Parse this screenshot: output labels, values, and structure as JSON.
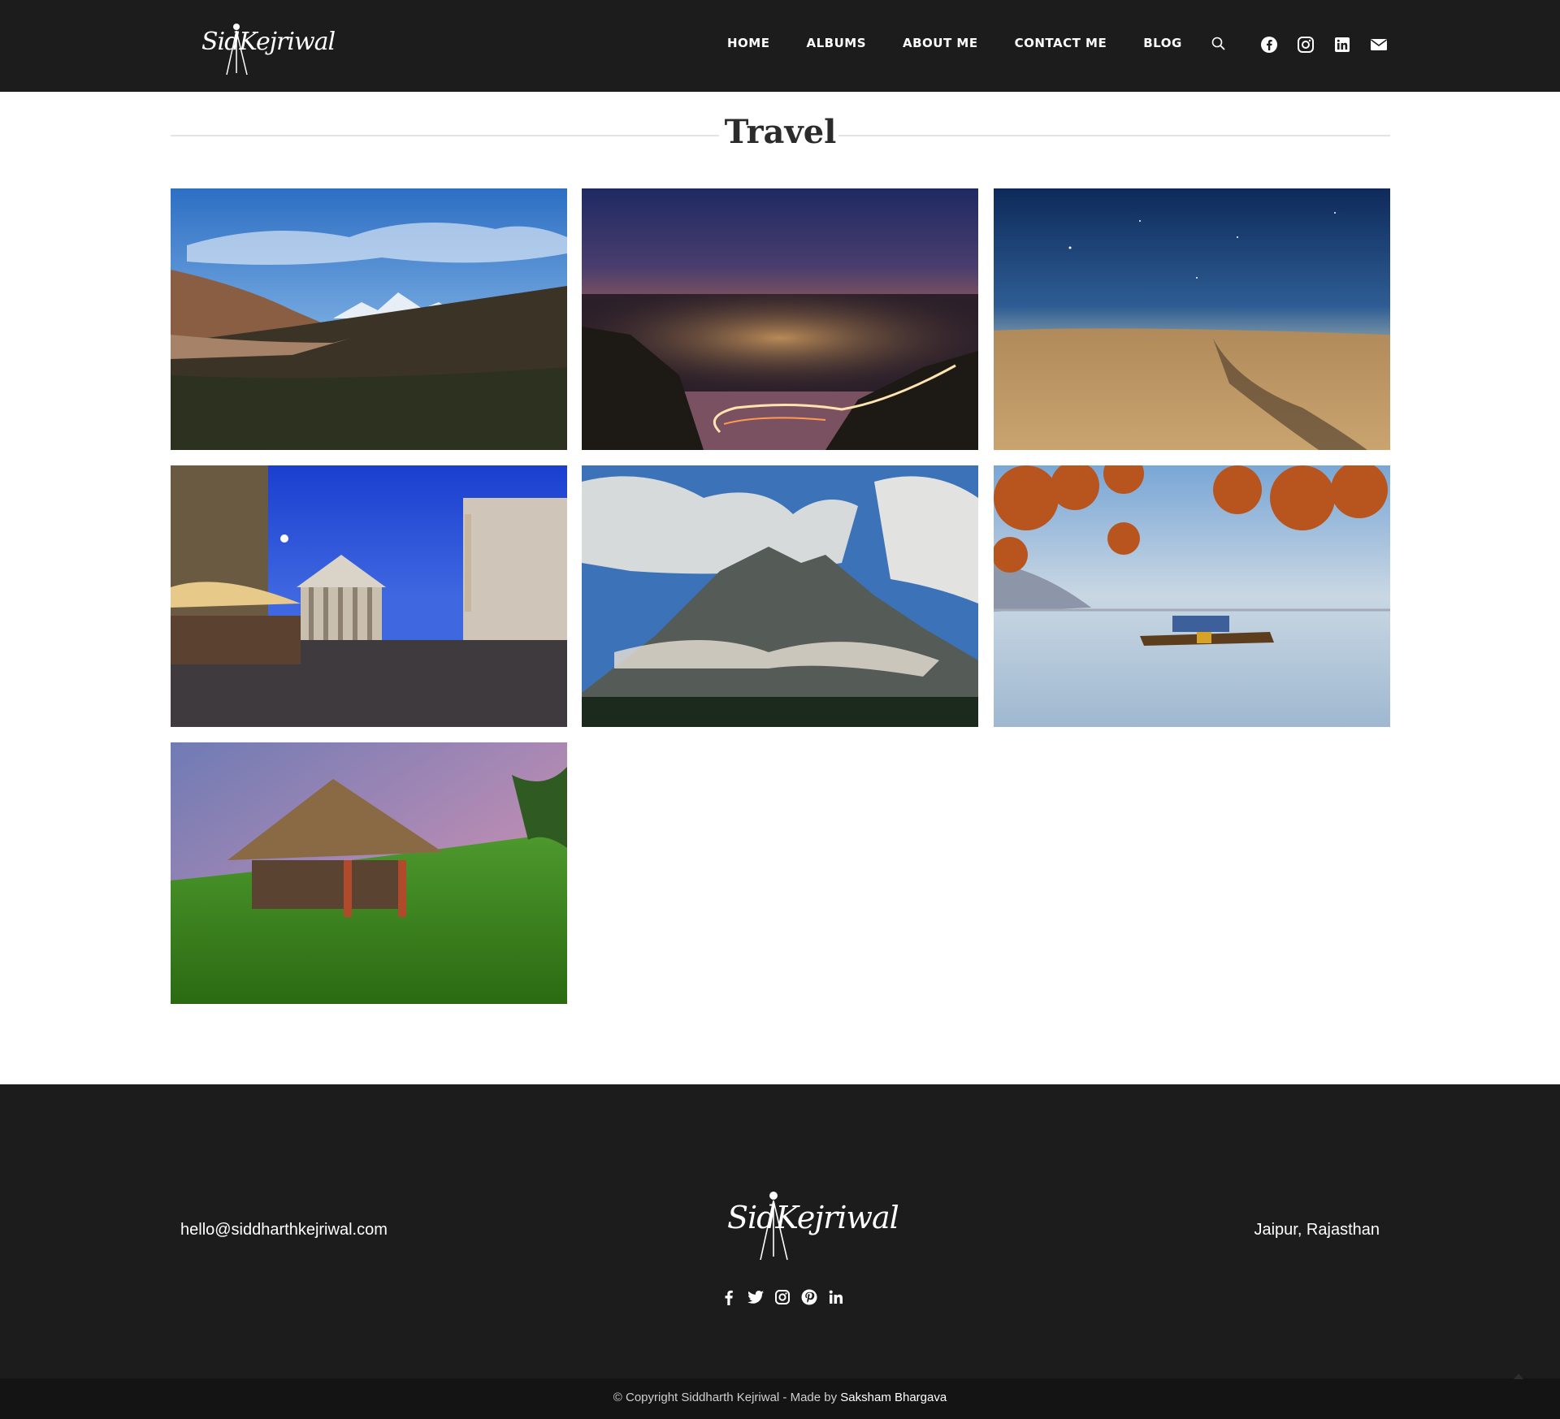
{
  "site": {
    "logo_text": "SidKejriwal"
  },
  "nav": {
    "items": [
      "HOME",
      "ALBUMS",
      "ABOUT ME",
      "CONTACT ME",
      "BLOG"
    ],
    "icons": [
      "search-icon",
      "facebook-icon",
      "instagram-icon",
      "linkedin-icon",
      "mail-icon"
    ]
  },
  "page": {
    "title": "Travel"
  },
  "gallery": {
    "photos": [
      {
        "name": "mountain-valley-photo"
      },
      {
        "name": "city-night-lights-photo"
      },
      {
        "name": "desert-dunes-stars-photo"
      },
      {
        "name": "pantheon-piazza-photo"
      },
      {
        "name": "cloudy-mountain-peak-photo"
      },
      {
        "name": "lake-boat-autumn-photo"
      },
      {
        "name": "thatched-hut-rice-field-photo"
      }
    ]
  },
  "footer": {
    "email": "hello@siddharthkejriwal.com",
    "location": "Jaipur, Rajasthan",
    "logo_text": "SidKejriwal",
    "social_icons": [
      "facebook-icon",
      "twitter-icon",
      "instagram-icon",
      "pinterest-icon",
      "linkedin-icon"
    ],
    "copyright_prefix": "© Copyright Siddharth Kejriwal - Made by",
    "copyright_author": "Saksham Bhargava"
  },
  "colors": {
    "header_bg": "#1c1c1c",
    "footer_bg": "#1c1c1c",
    "copyright_bg": "#141414",
    "title_text": "#2b2b2b"
  }
}
